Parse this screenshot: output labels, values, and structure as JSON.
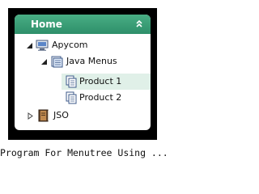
{
  "header": {
    "title": "Home",
    "icon": "double-chevron-up-icon"
  },
  "tree": [
    {
      "label": "Apycom",
      "icon": "computer-icon",
      "toggle": "expanded",
      "level": 1
    },
    {
      "label": "Java Menus",
      "icon": "folder-icon",
      "toggle": "expanded",
      "level": 2
    },
    {
      "label": "Product 1",
      "icon": "document-icon",
      "level": 3,
      "selected": true
    },
    {
      "label": "Product 2",
      "icon": "document-icon",
      "level": 3
    },
    {
      "label": "JSO",
      "icon": "book-icon",
      "toggle": "collapsed",
      "level": 1
    }
  ],
  "caption": "Program For Menutree Using ...",
  "colors": {
    "header": "#3a9e76",
    "selected_row": "#e0f0e8",
    "frame": "#000000"
  }
}
